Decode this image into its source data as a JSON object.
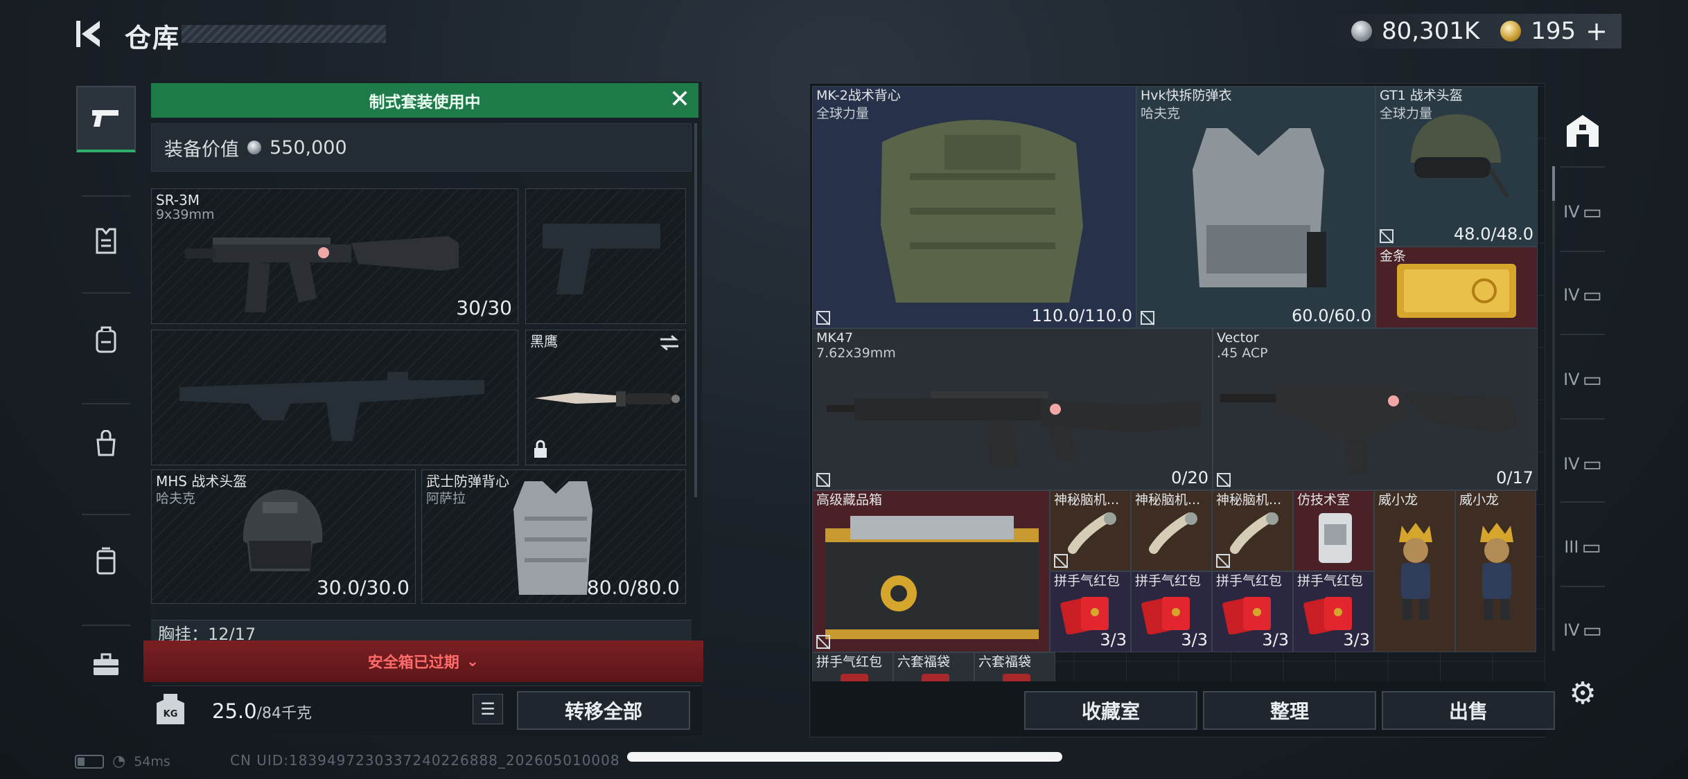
{
  "header": {
    "title": "仓库",
    "currency": [
      {
        "icon": "silver-coin-icon",
        "value": "80,301K"
      },
      {
        "icon": "gold-coin-icon",
        "value": "195",
        "action": "+"
      }
    ]
  },
  "left_nav": [
    {
      "icon": "pistol-icon",
      "active": true
    },
    {
      "icon": "vest-icon"
    },
    {
      "icon": "backpack-icon"
    },
    {
      "icon": "bag-icon"
    },
    {
      "icon": "pouch-icon"
    },
    {
      "icon": "toolbox-icon"
    }
  ],
  "loadout": {
    "banner": "制式套装使用中",
    "value_label": "装备价值",
    "value": "550,000",
    "slots": [
      {
        "name": "SR-3M",
        "sub": "9x39mm",
        "count": "30/30"
      },
      {
        "name": "黑鹰",
        "locked": true,
        "swap": true
      },
      {
        "name": "MHS 战术头盔",
        "sub": "哈夫克",
        "count": "30.0/30.0"
      },
      {
        "name": "武士防弹背心",
        "sub": "阿萨拉",
        "count": "80.0/80.0"
      }
    ],
    "chest_peek": "胸挂：12/17",
    "safe_box": "安全箱已过期",
    "weight": "25.0",
    "weight_max": "/84千克",
    "weight_icon_text": "KG",
    "transfer_all": "转移全部"
  },
  "stash": {
    "items": [
      {
        "name": "MK-2战术背心",
        "sub": "全球力量",
        "count": "110.0/110.0"
      },
      {
        "name": "Hvk快拆防弹衣",
        "sub": "哈夫克",
        "count": "60.0/60.0"
      },
      {
        "name": "GT1 战术头盔",
        "sub": "全球力量",
        "count": "48.0/48.0"
      },
      {
        "name": "金条"
      },
      {
        "name": "MK47",
        "sub": "7.62x39mm",
        "count": "0/20"
      },
      {
        "name": "Vector",
        "sub": ".45 ACP",
        "count": "0/17"
      },
      {
        "name": "高级藏品箱"
      },
      {
        "name": "神秘脑机..."
      },
      {
        "name": "神秘脑机..."
      },
      {
        "name": "神秘脑机..."
      },
      {
        "name": "仿技术室"
      },
      {
        "name": "威小龙"
      },
      {
        "name": "威小龙"
      },
      {
        "name": "拼手气红包",
        "count": "3/3"
      },
      {
        "name": "拼手气红包",
        "count": "3/3"
      },
      {
        "name": "拼手气红包",
        "count": "3/3"
      },
      {
        "name": "拼手气红包",
        "count": "3/3"
      },
      {
        "name": "拼手气红包"
      },
      {
        "name": "六套福袋"
      },
      {
        "name": "六套福袋"
      }
    ],
    "buttons": {
      "collection": "收藏室",
      "sort": "整理",
      "sell": "出售"
    }
  },
  "right_tabs": [
    {
      "icon": "all-items-icon",
      "active": true
    },
    {
      "label": "IV"
    },
    {
      "label": "IV"
    },
    {
      "label": "IV"
    },
    {
      "label": "IV"
    },
    {
      "label": "III"
    },
    {
      "label": "IV"
    }
  ],
  "footer": {
    "ping": "54ms",
    "uid": "CN UID:1839497230337240226888_202605010008"
  },
  "colors": {
    "accent_green": "#1f7a4a",
    "warning_red": "#ff6b6b",
    "rarity_blue": "#27324a",
    "rarity_red": "#4a2126",
    "rarity_gold": "#3e2d22"
  }
}
